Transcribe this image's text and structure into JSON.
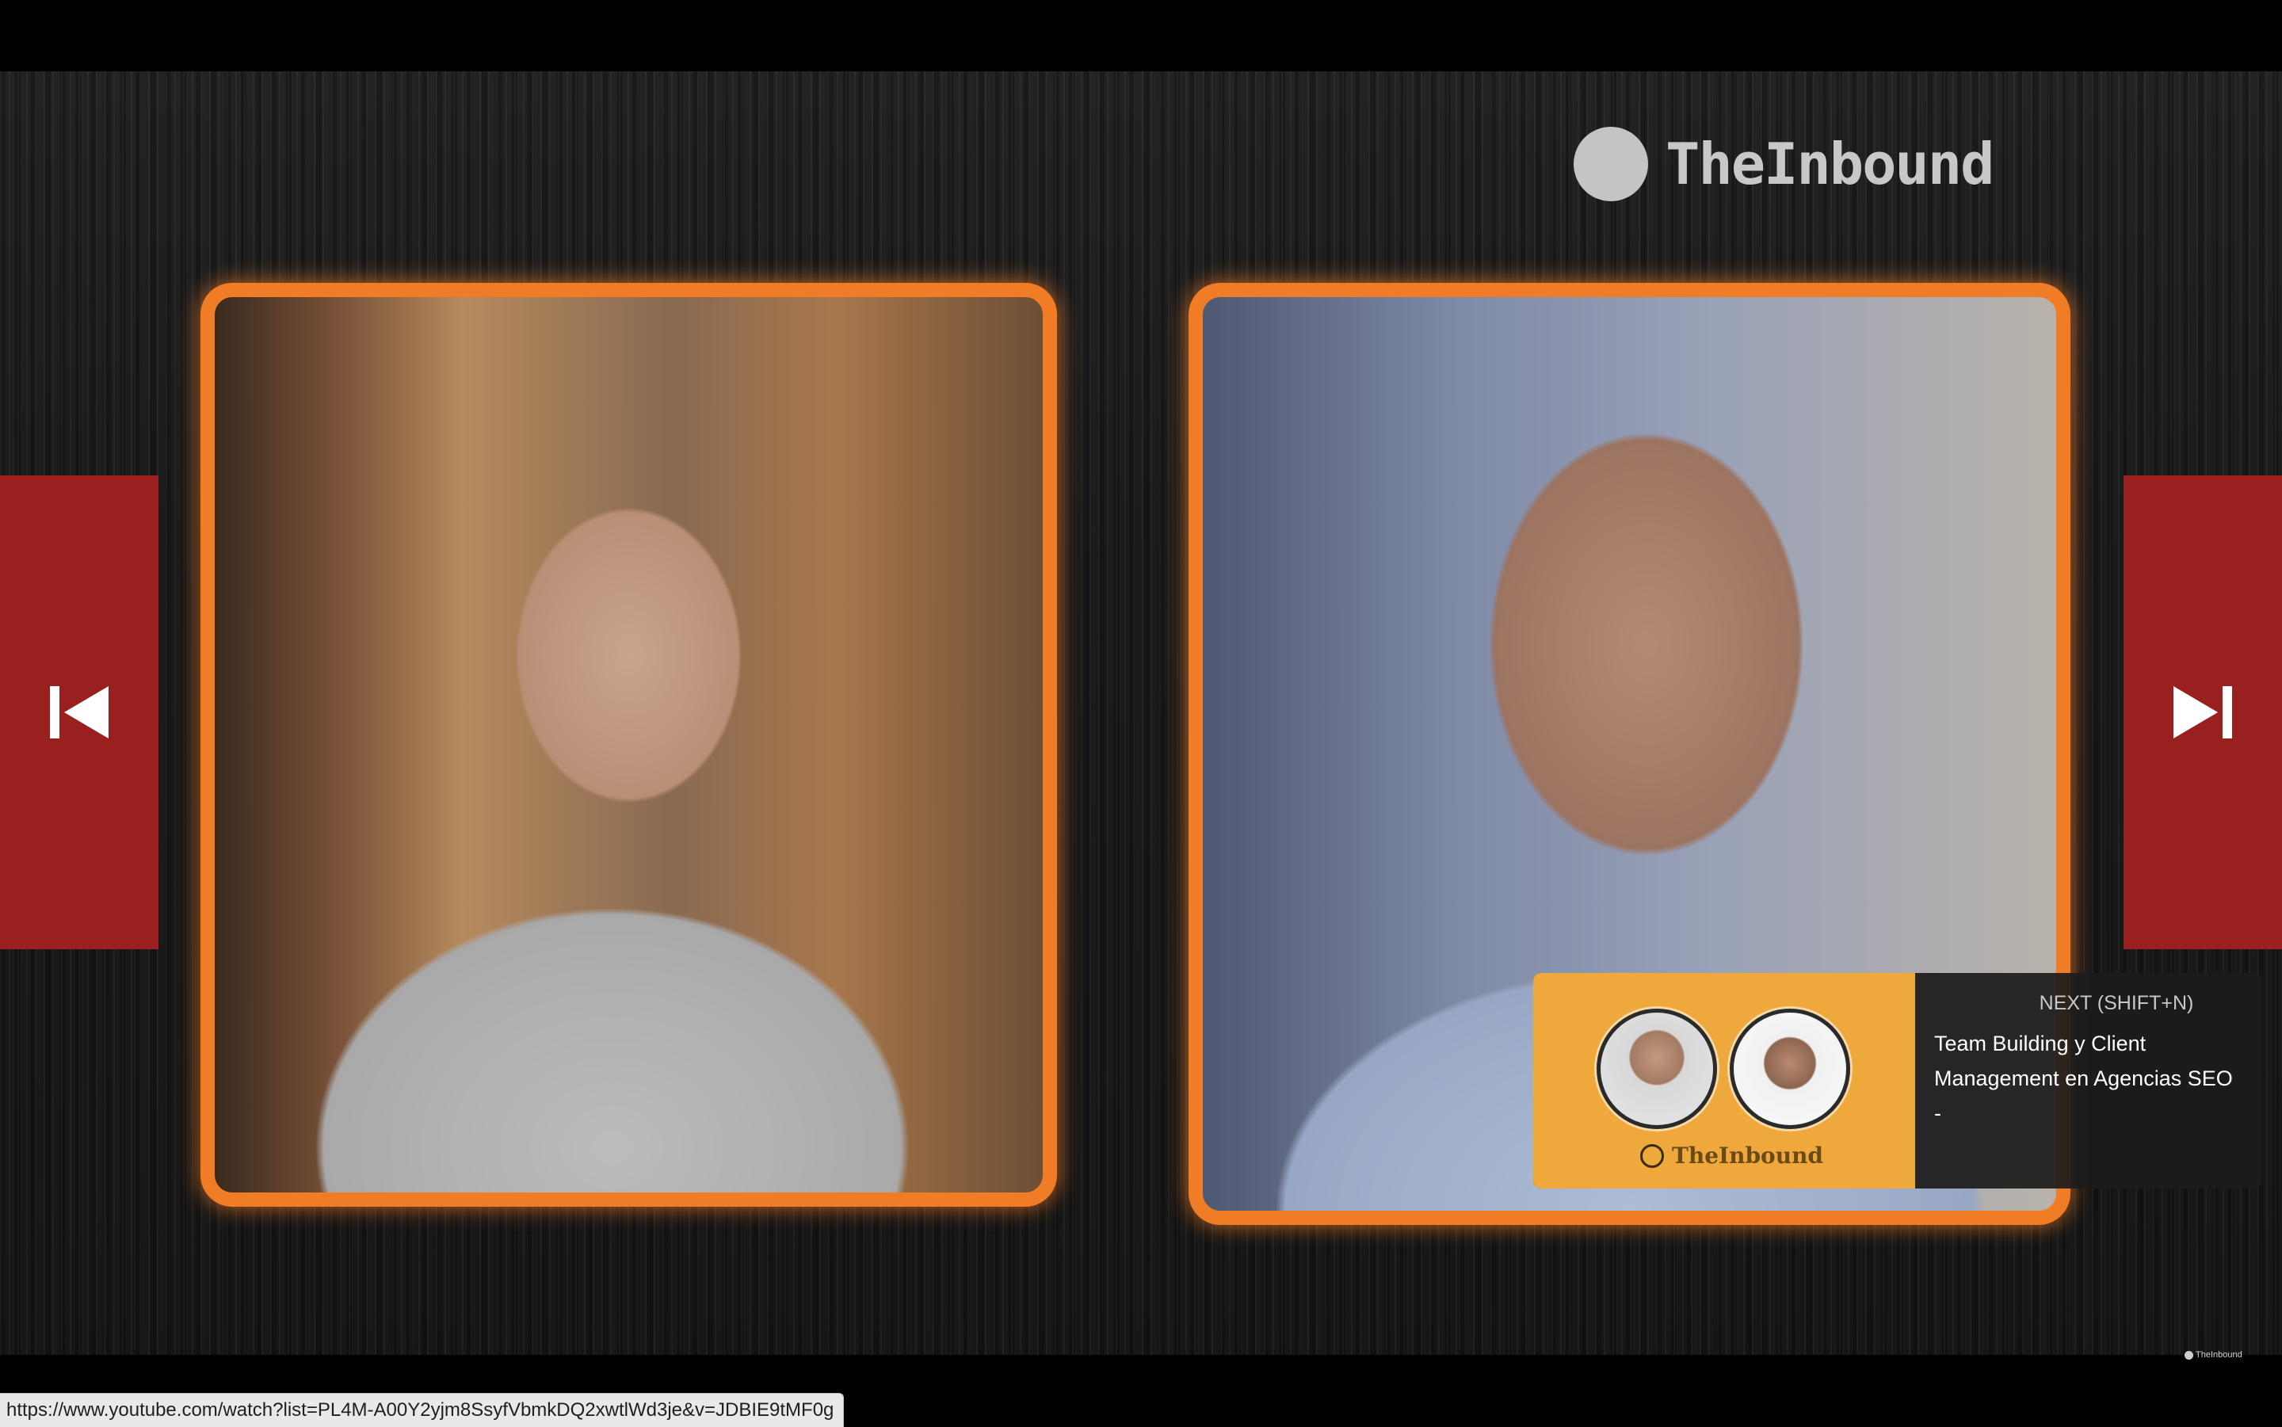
{
  "brand": {
    "name": "TheInbound",
    "icon": "circle-logo-icon"
  },
  "navigation": {
    "previous_icon": "skip-previous-icon",
    "next_icon": "skip-next-icon"
  },
  "next_up": {
    "heading": "NEXT (SHIFT+N)",
    "title": "Team Building y Client Management en Agencias SEO -",
    "thumbnail_brand": "TheInbound"
  },
  "watermark": {
    "text": "TheInbound"
  },
  "status_bar": {
    "url": "https://www.youtube.com/watch?list=PL4M-A00Y2yjm8SsyfVbmkDQ2xwtlWd3je&v=JDBIE9tMF0g"
  },
  "colors": {
    "frame_border": "#f07d26",
    "nav_button": "#9a2020",
    "thumbnail_bg": "#efa83c"
  }
}
